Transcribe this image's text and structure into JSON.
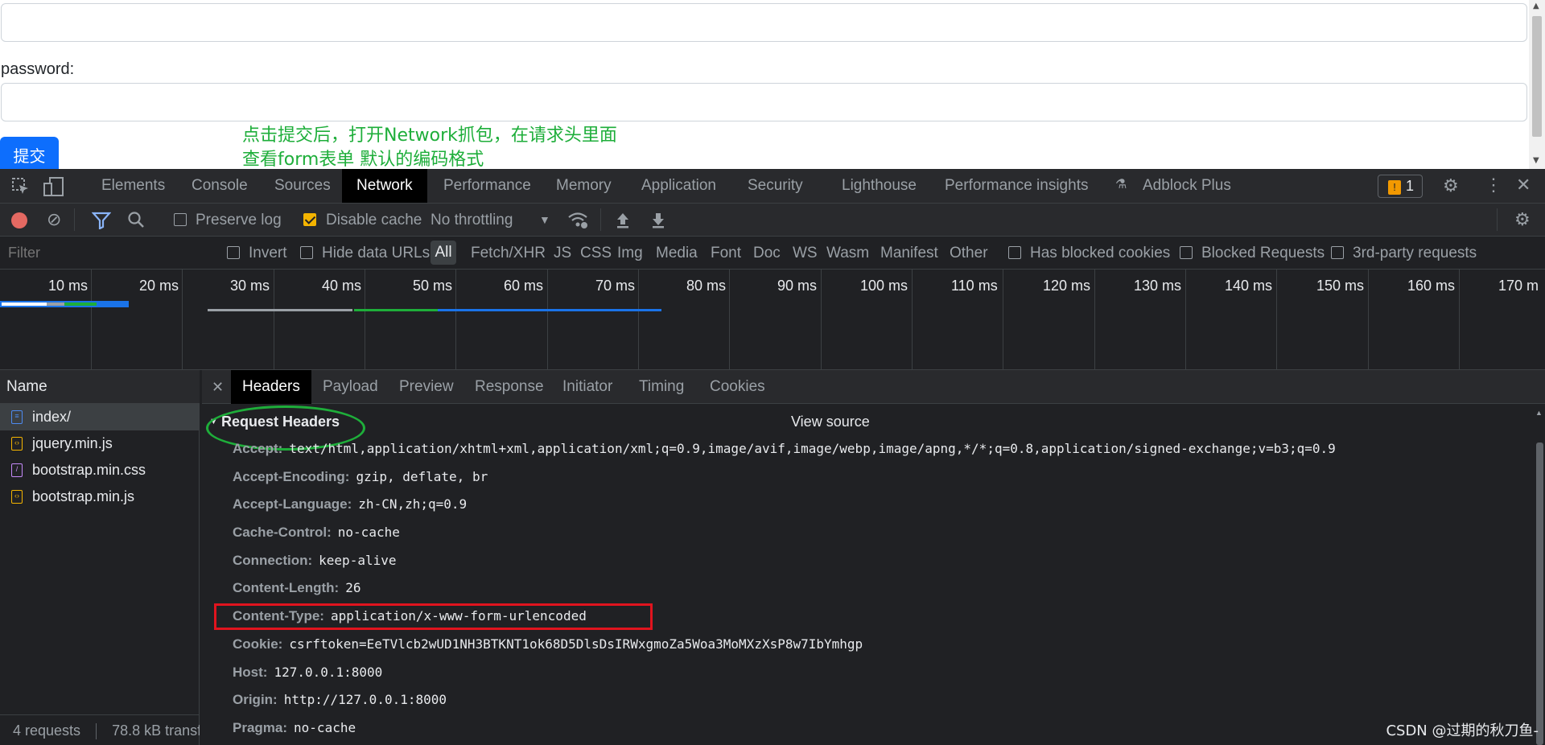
{
  "page": {
    "password_label": "password:",
    "submit_label": "提交",
    "annotation_line1": "点击提交后，打开Network抓包，在请求头里面",
    "annotation_line2": "查看form表单 默认的编码格式",
    "annotation_color": "#1eae3a"
  },
  "devtools": {
    "tabs": [
      "Elements",
      "Console",
      "Sources",
      "Network",
      "Performance",
      "Memory",
      "Application",
      "Security",
      "Lighthouse",
      "Performance insights",
      "Adblock Plus"
    ],
    "active_tab": "Network",
    "issues_count": "1",
    "toolbar": {
      "preserve_log": "Preserve log",
      "disable_cache": "Disable cache",
      "throttling": "No throttling"
    },
    "filter_bar": {
      "placeholder": "Filter",
      "invert": "Invert",
      "hide_data_urls": "Hide data URLs",
      "types": [
        "All",
        "Fetch/XHR",
        "JS",
        "CSS",
        "Img",
        "Media",
        "Font",
        "Doc",
        "WS",
        "Wasm",
        "Manifest",
        "Other"
      ],
      "has_blocked_cookies": "Has blocked cookies",
      "blocked_requests": "Blocked Requests",
      "third_party": "3rd-party requests"
    },
    "timeline_ticks": [
      "10 ms",
      "20 ms",
      "30 ms",
      "40 ms",
      "50 ms",
      "60 ms",
      "70 ms",
      "80 ms",
      "90 ms",
      "100 ms",
      "110 ms",
      "120 ms",
      "130 ms",
      "140 ms",
      "150 ms",
      "160 ms",
      "170 m"
    ],
    "name_header": "Name",
    "requests": [
      {
        "name": "index/",
        "type": "doc",
        "color": "#4d8af0"
      },
      {
        "name": "jquery.min.js",
        "type": "js",
        "color": "#f4b400"
      },
      {
        "name": "bootstrap.min.css",
        "type": "css",
        "color": "#c58af9"
      },
      {
        "name": "bootstrap.min.js",
        "type": "js",
        "color": "#f4b400"
      }
    ],
    "status_bar": {
      "requests": "4 requests",
      "transferred": "78.8 kB transf"
    },
    "detail_tabs": [
      "Headers",
      "Payload",
      "Preview",
      "Response",
      "Initiator",
      "Timing",
      "Cookies"
    ],
    "active_detail_tab": "Headers",
    "section_title": "Request Headers",
    "view_source": "View source",
    "headers": [
      {
        "key": "Accept:",
        "value": "text/html,application/xhtml+xml,application/xml;q=0.9,image/avif,image/webp,image/apng,*/*;q=0.8,application/signed-exchange;v=b3;q=0.9"
      },
      {
        "key": "Accept-Encoding:",
        "value": "gzip, deflate, br"
      },
      {
        "key": "Accept-Language:",
        "value": "zh-CN,zh;q=0.9"
      },
      {
        "key": "Cache-Control:",
        "value": "no-cache"
      },
      {
        "key": "Connection:",
        "value": "keep-alive"
      },
      {
        "key": "Content-Length:",
        "value": "26"
      },
      {
        "key": "Content-Type:",
        "value": "application/x-www-form-urlencoded"
      },
      {
        "key": "Cookie:",
        "value": "csrftoken=EeTVlcb2wUD1NH3BTKNT1ok68D5DlsDsIRWxgmoZa5Woa3MoMXzXsP8w7IbYmhgp"
      },
      {
        "key": "Host:",
        "value": "127.0.0.1:8000"
      },
      {
        "key": "Origin:",
        "value": "http://127.0.0.1:8000"
      },
      {
        "key": "Pragma:",
        "value": "no-cache"
      }
    ],
    "highlight_color": "#e0141e"
  },
  "watermark": "CSDN @过期的秋刀鱼-"
}
